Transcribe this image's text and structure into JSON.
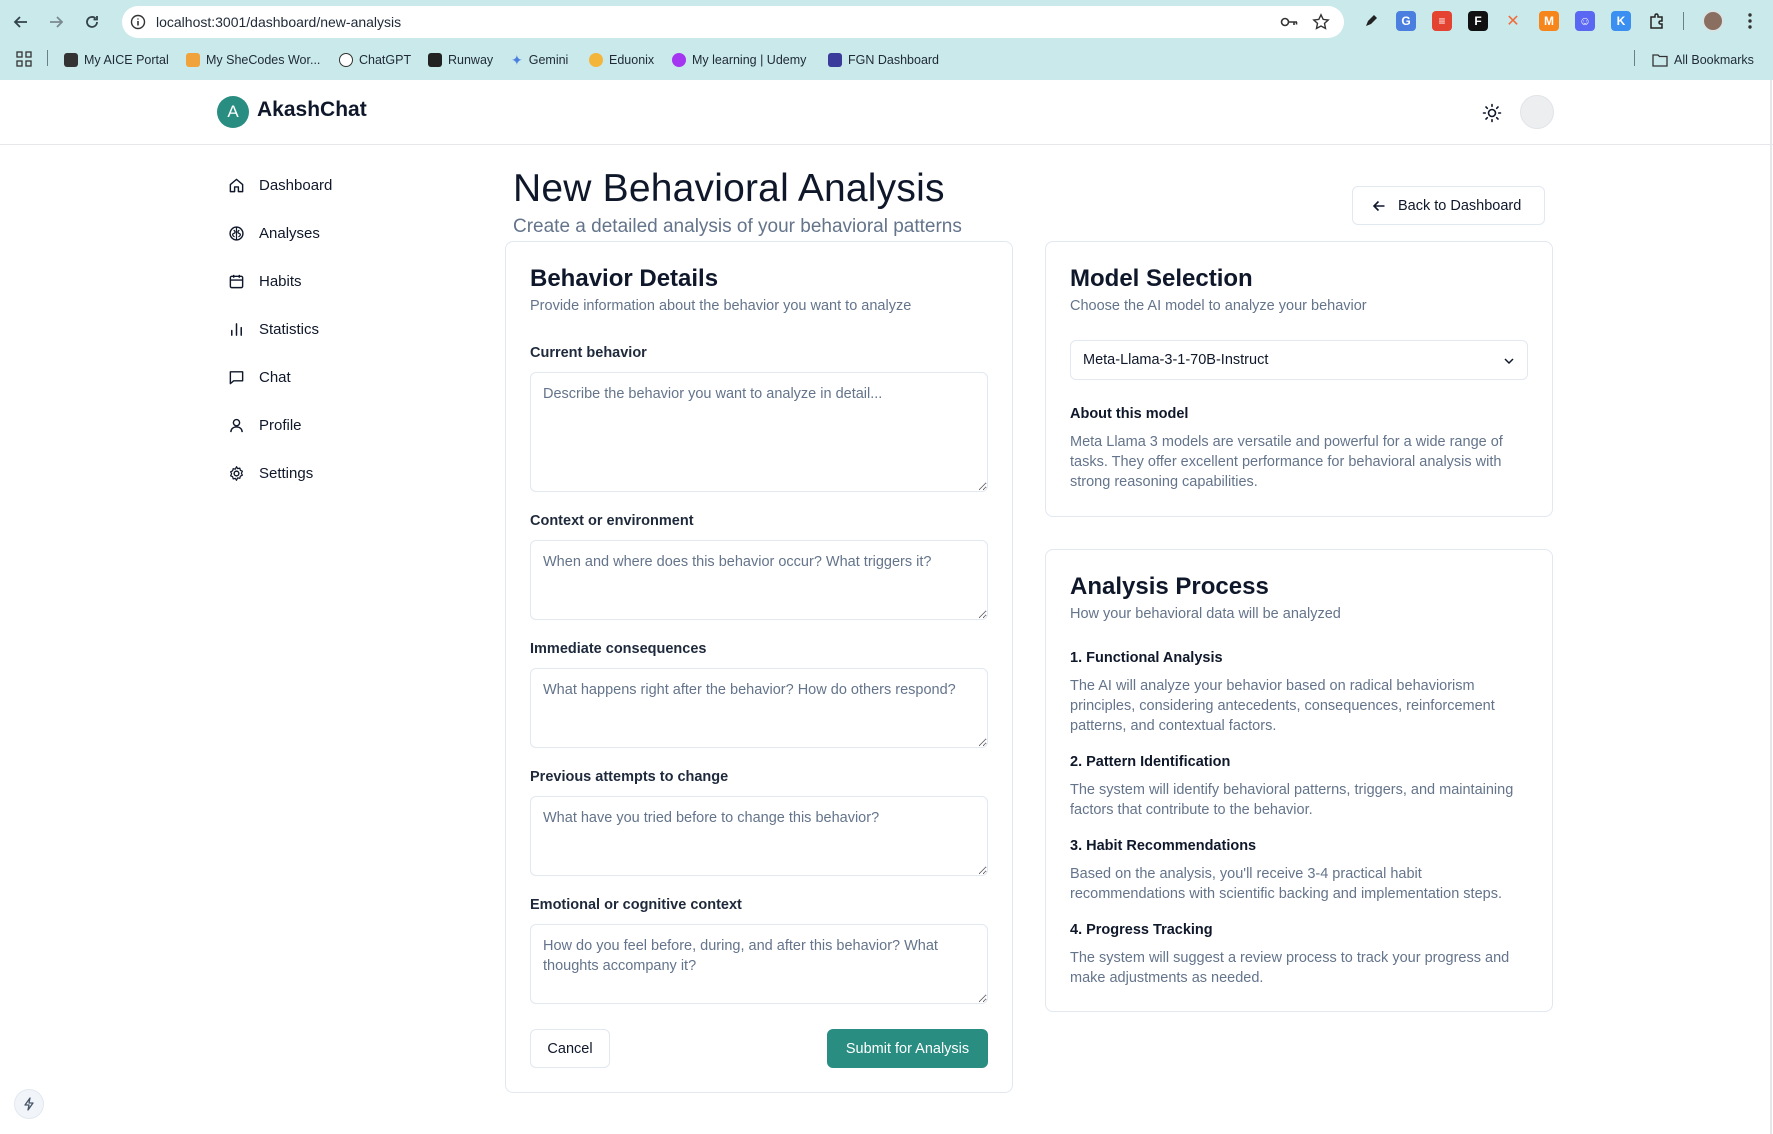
{
  "browser": {
    "url": "localhost:3001/dashboard/new-analysis",
    "bookmarks": [
      "My AICE Portal",
      "My SheCodes Wor...",
      "ChatGPT",
      "Runway",
      "Gemini",
      "Eduonix",
      "My learning | Udemy",
      "FGN Dashboard"
    ],
    "all_bookmarks": "All Bookmarks",
    "extensions": [
      "pen-icon",
      "translate-icon",
      "todoist-icon",
      "framer-icon",
      "spark-icon",
      "metamask-icon",
      "robot-icon",
      "k-icon",
      "puzzle-icon"
    ]
  },
  "app": {
    "logo_letter": "A",
    "name": "AkashChat"
  },
  "sidebar": {
    "items": [
      {
        "label": "Dashboard",
        "icon": "home-icon"
      },
      {
        "label": "Analyses",
        "icon": "brain-icon"
      },
      {
        "label": "Habits",
        "icon": "calendar-icon"
      },
      {
        "label": "Statistics",
        "icon": "bar-chart-icon"
      },
      {
        "label": "Chat",
        "icon": "message-icon"
      },
      {
        "label": "Profile",
        "icon": "user-icon"
      },
      {
        "label": "Settings",
        "icon": "gear-icon"
      }
    ]
  },
  "page": {
    "title": "New Behavioral Analysis",
    "subtitle": "Create a detailed analysis of your behavioral patterns",
    "back_label": "Back to Dashboard"
  },
  "behavior_card": {
    "title": "Behavior Details",
    "description": "Provide information about the behavior you want to analyze",
    "fields": [
      {
        "label": "Current behavior",
        "placeholder": "Describe the behavior you want to analyze in detail..."
      },
      {
        "label": "Context or environment",
        "placeholder": "When and where does this behavior occur? What triggers it?"
      },
      {
        "label": "Immediate consequences",
        "placeholder": "What happens right after the behavior? How do others respond?"
      },
      {
        "label": "Previous attempts to change",
        "placeholder": "What have you tried before to change this behavior?"
      },
      {
        "label": "Emotional or cognitive context",
        "placeholder": "How do you feel before, during, and after this behavior? What thoughts accompany it?"
      }
    ],
    "cancel_label": "Cancel",
    "submit_label": "Submit for Analysis"
  },
  "model_card": {
    "title": "Model Selection",
    "description": "Choose the AI model to analyze your behavior",
    "selected_model": "Meta-Llama-3-1-70B-Instruct",
    "about_heading": "About this model",
    "about_text": "Meta Llama 3 models are versatile and powerful for a wide range of tasks. They offer excellent performance for behavioral analysis with strong reasoning capabilities."
  },
  "process_card": {
    "title": "Analysis Process",
    "description": "How your behavioral data will be analyzed",
    "steps": [
      {
        "heading": "1. Functional Analysis",
        "text": "The AI will analyze your behavior based on radical behaviorism principles, considering antecedents, consequences, reinforcement patterns, and contextual factors."
      },
      {
        "heading": "2. Pattern Identification",
        "text": "The system will identify behavioral patterns, triggers, and maintaining factors that contribute to the behavior."
      },
      {
        "heading": "3. Habit Recommendations",
        "text": "Based on the analysis, you'll receive 3-4 practical habit recommendations with scientific backing and implementation steps."
      },
      {
        "heading": "4. Progress Tracking",
        "text": "The system will suggest a review process to track your progress and make adjustments as needed."
      }
    ]
  },
  "colors": {
    "accent": "#2a8d82",
    "chrome": "#c9e9ea",
    "muted_text": "#64748b",
    "border": "#e2e8f0"
  }
}
